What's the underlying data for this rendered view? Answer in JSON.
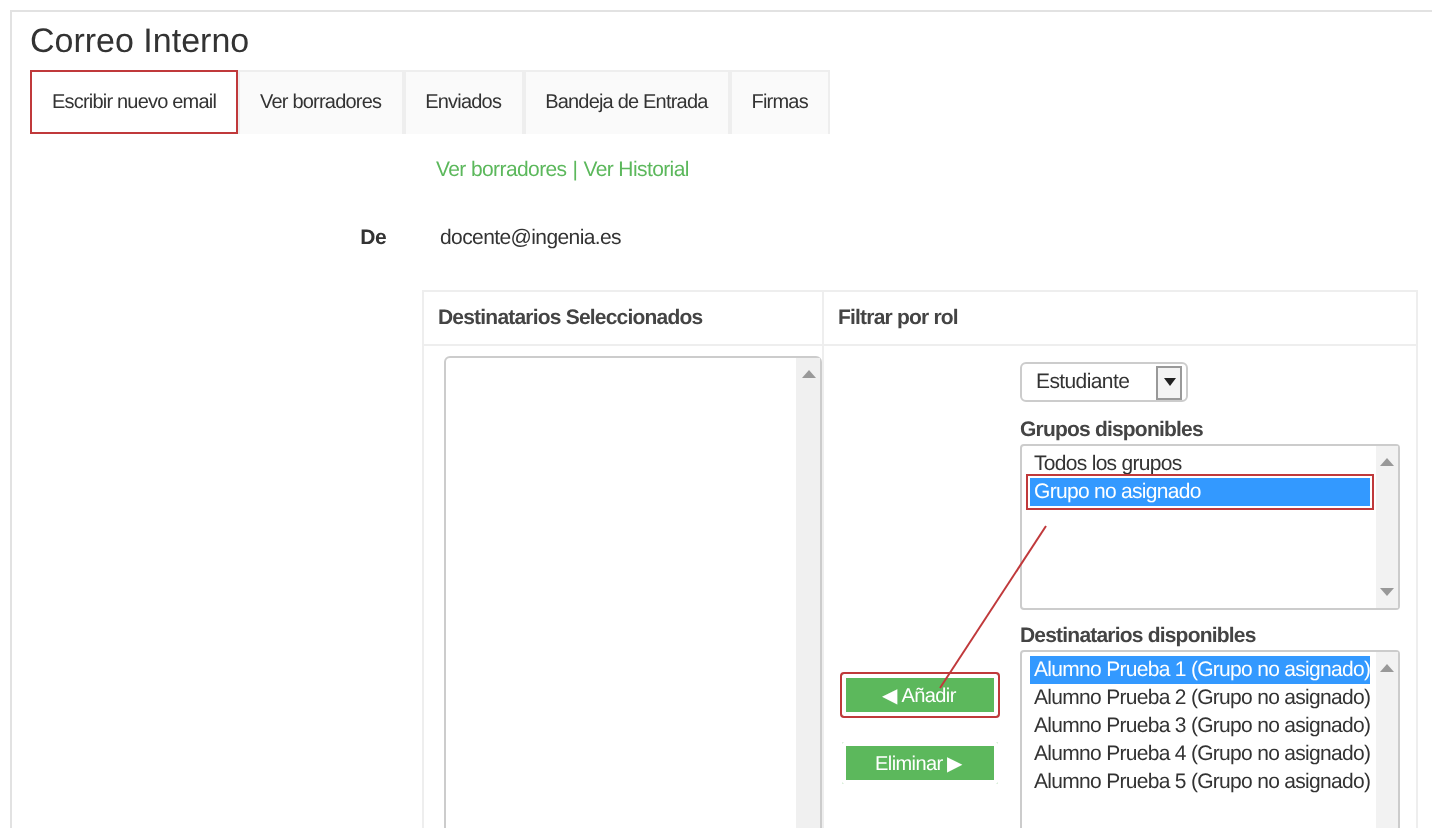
{
  "title": "Correo Interno",
  "tabs": [
    {
      "label": "Escribir nuevo email",
      "highlighted": true
    },
    {
      "label": "Ver borradores",
      "highlighted": false
    },
    {
      "label": "Enviados",
      "highlighted": false
    },
    {
      "label": "Bandeja de Entrada",
      "highlighted": false
    },
    {
      "label": "Firmas",
      "highlighted": false
    }
  ],
  "links": [
    "Ver borradores",
    "Ver Historial"
  ],
  "link_separator": "|",
  "from": {
    "label": "De",
    "value": "docente@ingenia.es"
  },
  "selected_recipients": {
    "heading": "Destinatarios Seleccionados"
  },
  "filter": {
    "heading": "Filtrar por rol",
    "role": "Estudiante",
    "groups_label": "Grupos disponibles",
    "groups": [
      {
        "label": "Todos los grupos",
        "selected": false,
        "highlighted": false
      },
      {
        "label": "Grupo no asignado",
        "selected": true,
        "highlighted": true
      }
    ],
    "recipients_label": "Destinatarios disponibles",
    "recipients": [
      {
        "label": "Alumno Prueba 1 (Grupo no asignado)",
        "selected": true
      },
      {
        "label": "Alumno Prueba 2 (Grupo no asignado)",
        "selected": false
      },
      {
        "label": "Alumno Prueba 3 (Grupo no asignado)",
        "selected": false
      },
      {
        "label": "Alumno Prueba 4 (Grupo no asignado)",
        "selected": false
      },
      {
        "label": "Alumno Prueba 5 (Grupo no asignado)",
        "selected": false
      }
    ]
  },
  "buttons": [
    {
      "label": "◀ Añadir",
      "highlighted": true
    },
    {
      "label": "Eliminar ▶",
      "highlighted": false
    }
  ]
}
